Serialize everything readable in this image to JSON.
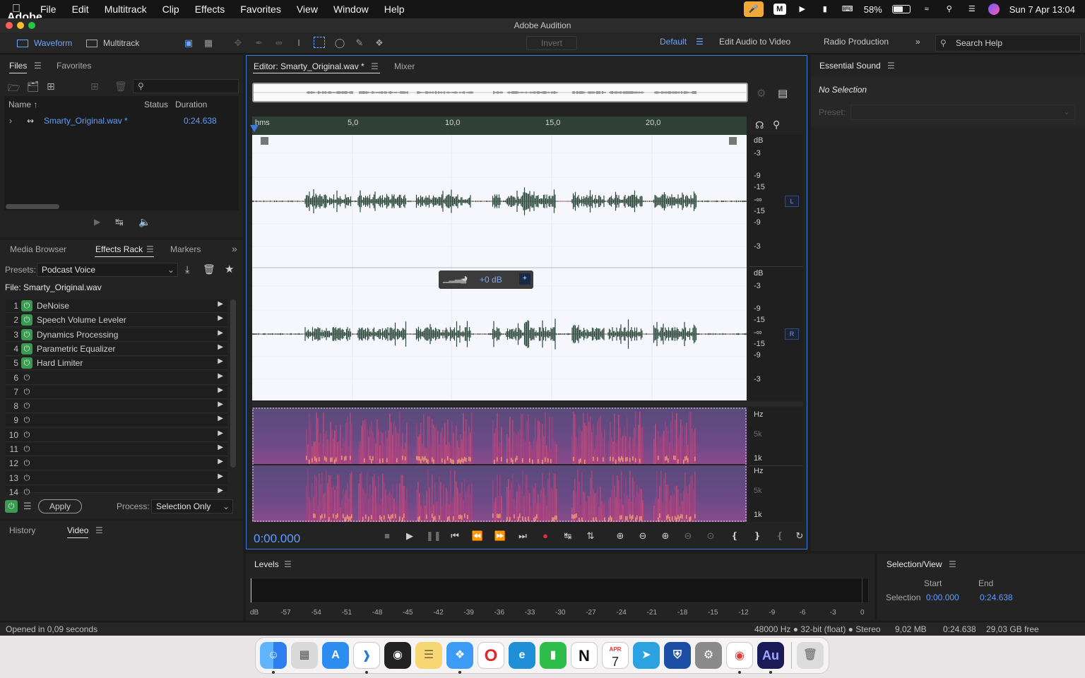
{
  "menubar": {
    "app_name": "Adobe Audition",
    "items": [
      "File",
      "Edit",
      "Multitrack",
      "Clip",
      "Effects",
      "Favorites",
      "View",
      "Window",
      "Help"
    ],
    "battery": "58%",
    "battery_level": 0.58,
    "datetime": "Sun 7 Apr  13:04"
  },
  "window": {
    "title": "Adobe Audition"
  },
  "toolbar": {
    "waveform": "Waveform",
    "multitrack": "Multitrack",
    "invert": "Invert",
    "workspaces": [
      "Default",
      "Edit Audio to Video",
      "Radio Production"
    ],
    "search_help": "Search Help"
  },
  "files_panel": {
    "tabs": [
      "Files",
      "Favorites"
    ],
    "columns": {
      "name": "Name",
      "status": "Status",
      "duration": "Duration"
    },
    "files": [
      {
        "name": "Smarty_Original.wav *",
        "duration": "0:24.638"
      }
    ]
  },
  "effects_panel": {
    "tabs": [
      "Media Browser",
      "Effects Rack",
      "Markers"
    ],
    "presets_label": "Presets:",
    "preset": "Podcast Voice",
    "file_label": "File: Smarty_Original.wav",
    "slots": [
      {
        "num": "1",
        "name": "DeNoise",
        "on": true
      },
      {
        "num": "2",
        "name": "Speech Volume Leveler",
        "on": true
      },
      {
        "num": "3",
        "name": "Dynamics Processing",
        "on": true
      },
      {
        "num": "4",
        "name": "Parametric Equalizer",
        "on": true
      },
      {
        "num": "5",
        "name": "Hard Limiter",
        "on": true
      },
      {
        "num": "6",
        "name": "",
        "on": false
      },
      {
        "num": "7",
        "name": "",
        "on": false
      },
      {
        "num": "8",
        "name": "",
        "on": false
      },
      {
        "num": "9",
        "name": "",
        "on": false
      },
      {
        "num": "10",
        "name": "",
        "on": false
      },
      {
        "num": "11",
        "name": "",
        "on": false
      },
      {
        "num": "12",
        "name": "",
        "on": false
      },
      {
        "num": "13",
        "name": "",
        "on": false
      },
      {
        "num": "14",
        "name": "",
        "on": false
      }
    ],
    "apply": "Apply",
    "process_label": "Process:",
    "process": "Selection Only"
  },
  "history_panel": {
    "tabs": [
      "History",
      "Video"
    ]
  },
  "editor": {
    "tabs": [
      "Editor: Smarty_Original.wav *",
      "Mixer"
    ],
    "ruler_ticks": [
      "hms",
      "5,0",
      "10,0",
      "15,0",
      "20,0"
    ],
    "db_labels": [
      "dB",
      "-3",
      "-9",
      "-15",
      "-∞",
      "-15",
      "-9",
      "-3"
    ],
    "channels": [
      "L",
      "R"
    ],
    "hud_gain": "+0 dB",
    "hz_labels": [
      "Hz",
      "5k",
      "1k"
    ],
    "time": "0:00.000"
  },
  "essential_sound": {
    "title": "Essential Sound",
    "no_selection": "No Selection",
    "preset_label": "Preset:"
  },
  "levels": {
    "title": "Levels",
    "ticks": [
      "dB",
      "-57",
      "-54",
      "-51",
      "-48",
      "-45",
      "-42",
      "-39",
      "-36",
      "-33",
      "-30",
      "-27",
      "-24",
      "-21",
      "-18",
      "-15",
      "-12",
      "-9",
      "-6",
      "-3",
      "0"
    ]
  },
  "selection_view": {
    "title": "Selection/View",
    "start_label": "Start",
    "end_label": "End",
    "row_label": "Selection",
    "start": "0:00.000",
    "end": "0:24.638"
  },
  "status_bar": {
    "message": "Opened in 0,09 seconds",
    "format": "48000 Hz ● 32-bit (float) ● Stereo",
    "size": "9,02 MB",
    "duration": "0:24.638",
    "free": "29,03 GB free"
  },
  "dock": {
    "calendar_month": "APR",
    "calendar_day": "7",
    "audition_label": "Au"
  }
}
